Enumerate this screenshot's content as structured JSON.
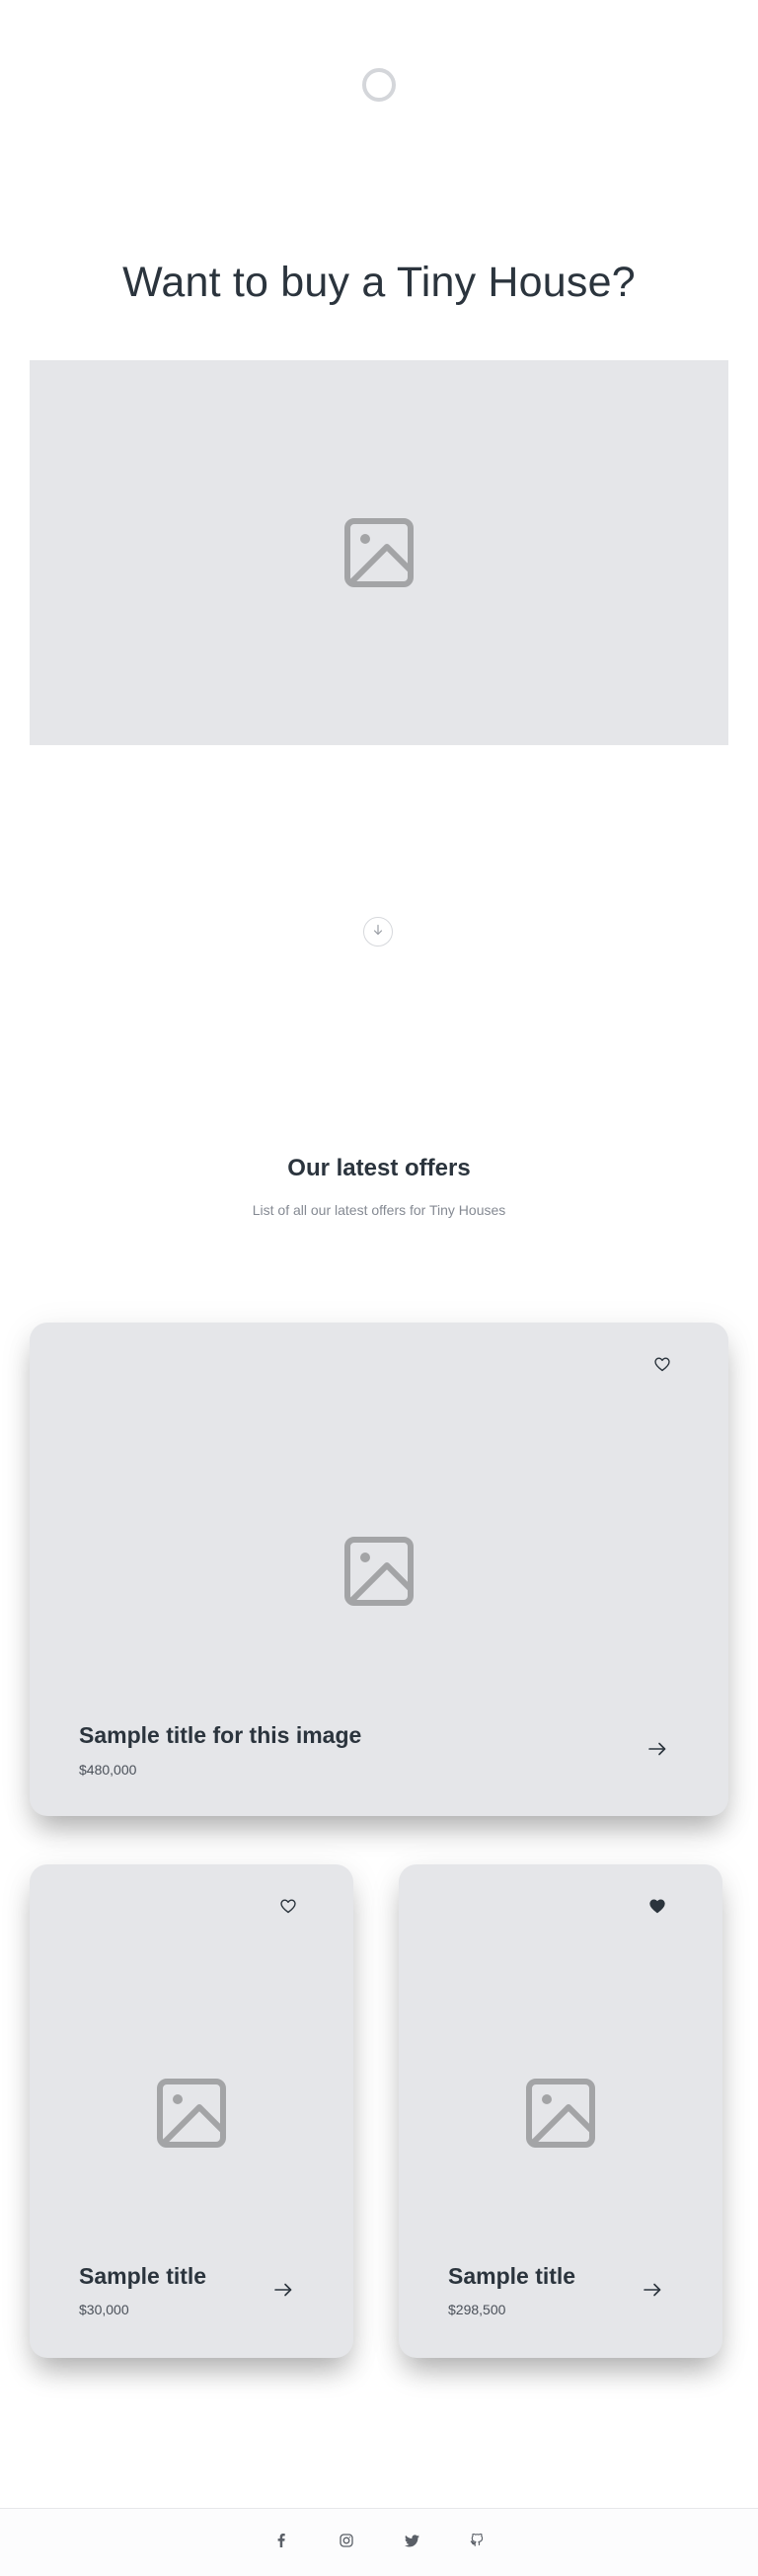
{
  "hero": {
    "title": "Want to buy a Tiny House?",
    "image_icon": "image-placeholder-icon"
  },
  "scroll": {
    "icon": "arrow-down-icon"
  },
  "offers": {
    "title": "Our latest offers",
    "subtitle": "List of all our latest offers for Tiny Houses",
    "items": [
      {
        "title": "Sample title for this image",
        "price": "$480,000",
        "favorite": false
      },
      {
        "title": "Sample title",
        "price": "$30,000",
        "favorite": false
      },
      {
        "title": "Sample title",
        "price": "$298,500",
        "favorite": true
      }
    ]
  },
  "footer": {
    "socials": [
      "facebook-icon",
      "instagram-icon",
      "twitter-icon",
      "github-icon"
    ]
  },
  "colors": {
    "placeholder_bg": "#e5e6e9",
    "placeholder_icon": "#a3a4a6",
    "text_dark": "#2b343d",
    "text_muted": "#858a93"
  }
}
